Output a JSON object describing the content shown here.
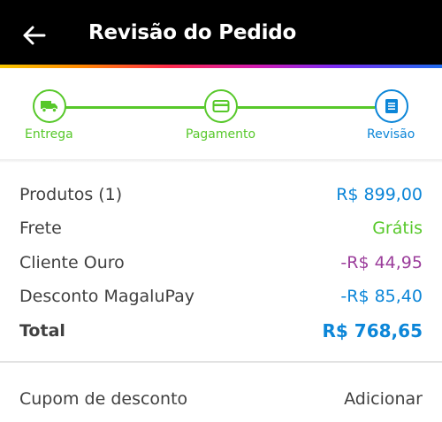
{
  "header": {
    "title": "Revisão do Pedido",
    "back_icon": "arrow-left-icon",
    "background": "#000000"
  },
  "stepper": {
    "steps": [
      {
        "label": "Entrega",
        "icon": "truck-icon",
        "state": "completed"
      },
      {
        "label": "Pagamento",
        "icon": "credit-card-icon",
        "state": "completed"
      },
      {
        "label": "Revisão",
        "icon": "document-list-icon",
        "state": "current"
      }
    ]
  },
  "summary": {
    "rows": [
      {
        "label": "Produtos (1)",
        "value": "R$ 899,00"
      },
      {
        "label": "Frete",
        "value": "Grátis"
      },
      {
        "label": "Cliente Ouro",
        "value": "-R$ 44,95"
      },
      {
        "label": "Desconto MagaluPay",
        "value": "-R$ 85,40"
      }
    ],
    "total": {
      "label": "Total",
      "value": "R$ 768,65"
    }
  },
  "coupon": {
    "label": "Cupom de desconto",
    "action": "Adicionar"
  },
  "colors": {
    "green": "#57c82a",
    "blue": "#0c86d8",
    "purple": "#9b3d9b",
    "text": "#404040"
  }
}
